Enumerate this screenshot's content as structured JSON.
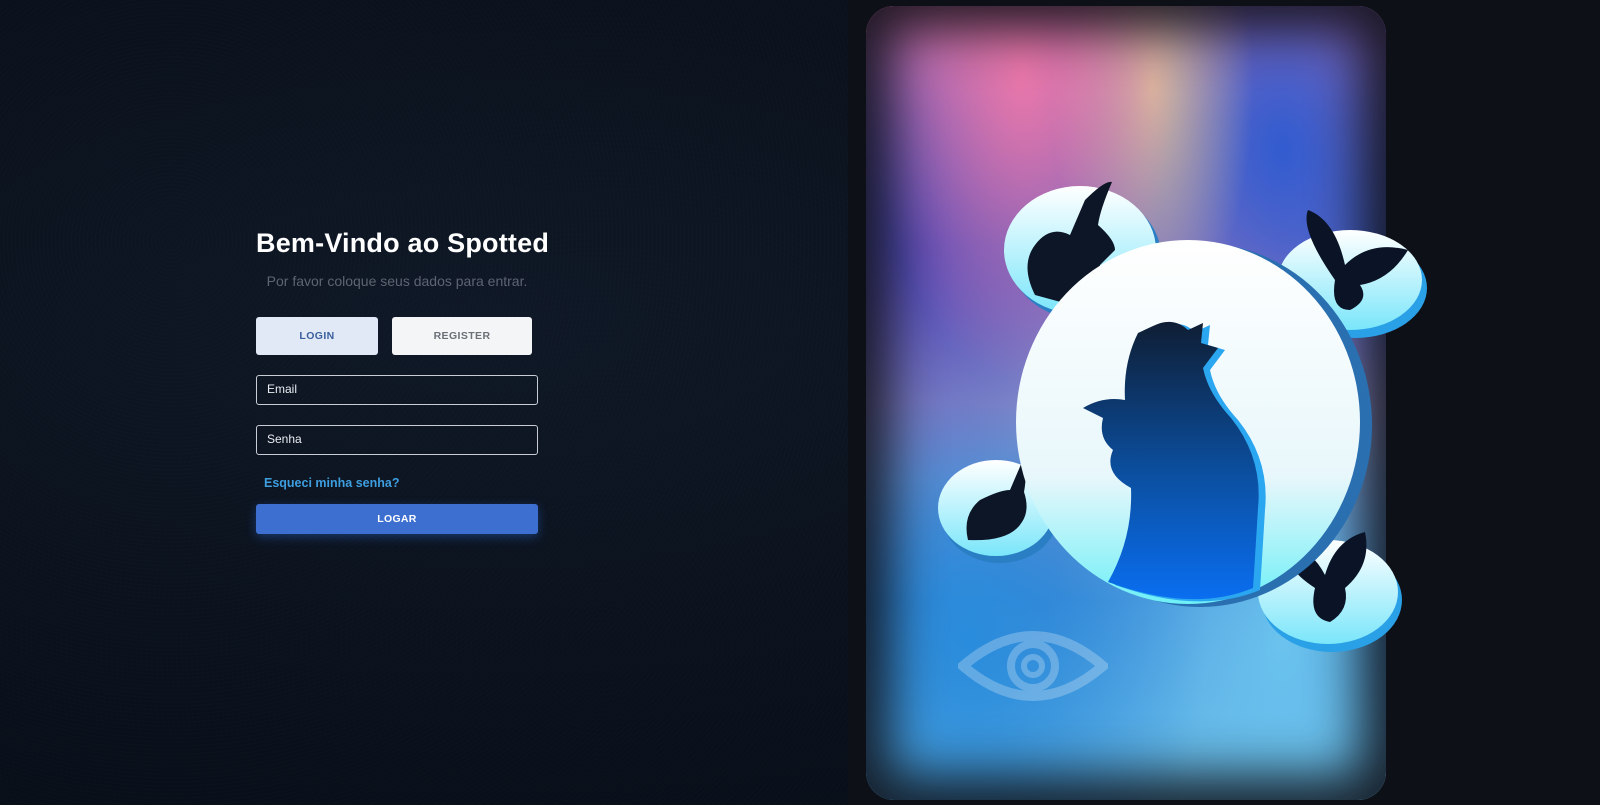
{
  "login": {
    "title": "Bem-Vindo ao Spotted",
    "subtitle": "Por favor coloque seus dados para entrar.",
    "tabs": [
      {
        "label": "LOGIN",
        "active": true
      },
      {
        "label": "REGISTER",
        "active": false
      }
    ],
    "fields": {
      "email_label": "Email",
      "password_label": "Senha"
    },
    "forgot_link": "Esqueci minha senha?",
    "submit_label": "LOGAR"
  },
  "illustration": {
    "icons": [
      "rooster-icon",
      "rabbit-icon",
      "butterfly-icon",
      "eye-icon"
    ]
  },
  "colors": {
    "background": "#0a111c",
    "accent": "#3c6fcf",
    "link": "#3d9ee0",
    "tab_active_bg": "#e2e9f6",
    "tab_active_text": "#3a5f9e"
  }
}
